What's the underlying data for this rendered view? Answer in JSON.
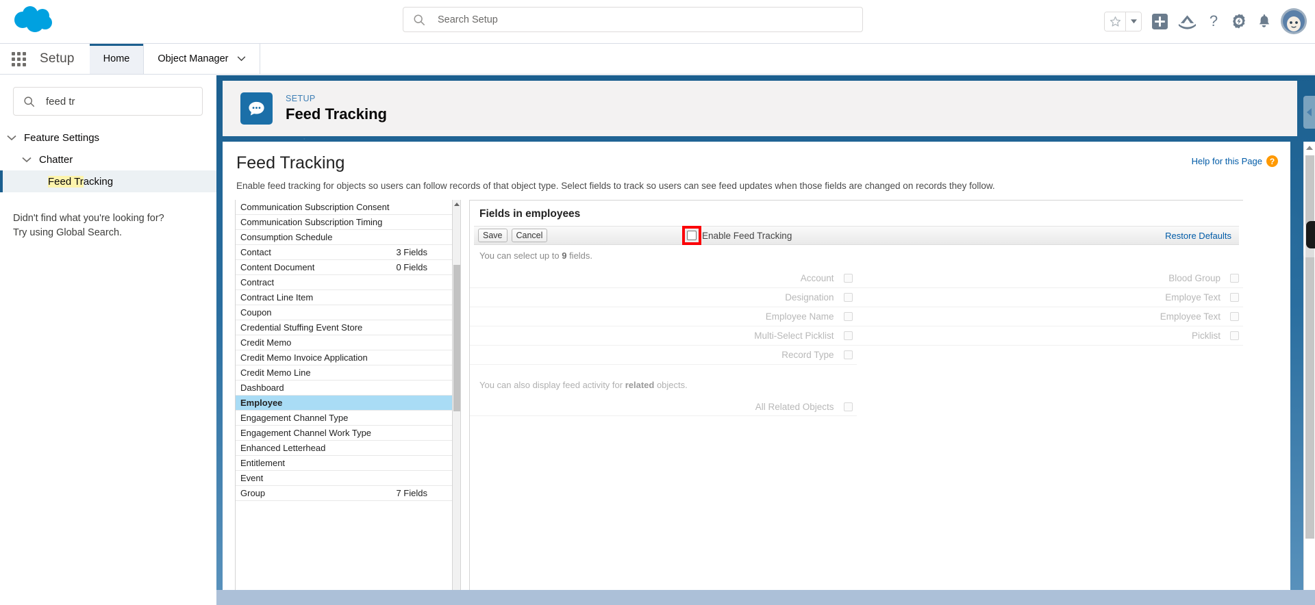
{
  "header": {
    "logo_icon": "salesforce-cloud-logo",
    "search": {
      "placeholder": "Search Setup",
      "value": "",
      "icon": "search-icon"
    },
    "icons": [
      {
        "name": "favorites-star-icon",
        "glyph": "star"
      },
      {
        "name": "favorites-dropdown-icon",
        "glyph": "caret-down"
      },
      {
        "name": "add-favorite-icon",
        "glyph": "plus-square"
      },
      {
        "name": "global-actions-icon",
        "glyph": "cloud-mountain"
      },
      {
        "name": "help-icon",
        "glyph": "question"
      },
      {
        "name": "setup-gear-icon",
        "glyph": "gear"
      },
      {
        "name": "notifications-bell-icon",
        "glyph": "bell"
      },
      {
        "name": "user-avatar",
        "glyph": "astro-avatar"
      }
    ]
  },
  "setup_nav": {
    "app_launcher_icon": "app-launcher-waffle-icon",
    "app_name": "Setup",
    "tabs": [
      {
        "label": "Home",
        "active": true,
        "has_caret": false
      },
      {
        "label": "Object Manager",
        "active": false,
        "has_caret": true
      }
    ]
  },
  "sidebar": {
    "search": {
      "value": "feed tr",
      "placeholder": "Quick Find",
      "icon": "search-icon"
    },
    "tree": [
      {
        "label": "Feature Settings",
        "level": 1,
        "expanded": true,
        "selected": false
      },
      {
        "label": "Chatter",
        "level": 2,
        "expanded": true,
        "selected": false
      },
      {
        "label": "Feed Tracking",
        "level": 3,
        "expanded": false,
        "selected": true,
        "highlight": "Feed Tr"
      }
    ],
    "note_line1": "Didn't find what you're looking for?",
    "note_line2": "Try using Global Search."
  },
  "page_header": {
    "icon": "chatter-feed-icon",
    "eyebrow": "SETUP",
    "title": "Feed Tracking"
  },
  "classic": {
    "help_link": "Help for this Page",
    "help_icon": "help-question-icon",
    "heading": "Feed Tracking",
    "description": "Enable feed tracking for objects so users can follow records of that object type. Select fields to track so users can see feed updates when those fields are changed on records they follow."
  },
  "object_list": {
    "selected": "Employee",
    "items": [
      {
        "name": "Communication Subscription Consent",
        "fields": ""
      },
      {
        "name": "Communication Subscription Timing",
        "fields": ""
      },
      {
        "name": "Consumption Schedule",
        "fields": ""
      },
      {
        "name": "Contact",
        "fields": "3 Fields"
      },
      {
        "name": "Content Document",
        "fields": "0 Fields"
      },
      {
        "name": "Contract",
        "fields": ""
      },
      {
        "name": "Contract Line Item",
        "fields": ""
      },
      {
        "name": "Coupon",
        "fields": ""
      },
      {
        "name": "Credential Stuffing Event Store",
        "fields": ""
      },
      {
        "name": "Credit Memo",
        "fields": ""
      },
      {
        "name": "Credit Memo Invoice Application",
        "fields": ""
      },
      {
        "name": "Credit Memo Line",
        "fields": ""
      },
      {
        "name": "Dashboard",
        "fields": ""
      },
      {
        "name": "Employee",
        "fields": ""
      },
      {
        "name": "Engagement Channel Type",
        "fields": ""
      },
      {
        "name": "Engagement Channel Work Type",
        "fields": ""
      },
      {
        "name": "Enhanced Letterhead",
        "fields": ""
      },
      {
        "name": "Entitlement",
        "fields": ""
      },
      {
        "name": "Event",
        "fields": ""
      },
      {
        "name": "Group",
        "fields": "7 Fields"
      }
    ]
  },
  "fields_panel": {
    "title": "Fields in employees",
    "save_label": "Save",
    "cancel_label": "Cancel",
    "enable_label": "Enable Feed Tracking",
    "enable_checked": false,
    "enable_highlighted": true,
    "highlight_color": "#fb0007",
    "restore_label": "Restore Defaults",
    "limit_note_pre": "You can select up to ",
    "limit_note_num": "9",
    "limit_note_post": " fields.",
    "left_fields": [
      {
        "label": "Account",
        "checked": false
      },
      {
        "label": "Designation",
        "checked": false
      },
      {
        "label": "Employee Name",
        "checked": false
      },
      {
        "label": "Multi-Select Picklist",
        "checked": false
      },
      {
        "label": "Record Type",
        "checked": false
      }
    ],
    "right_fields": [
      {
        "label": "Blood Group",
        "checked": false
      },
      {
        "label": "Employe Text",
        "checked": false
      },
      {
        "label": "Employee Text",
        "checked": false
      },
      {
        "label": "Picklist",
        "checked": false
      }
    ],
    "related_note_pre": "You can also display feed activity for ",
    "related_note_bold": "related",
    "related_note_post": " objects.",
    "all_related_label": "All Related Objects",
    "all_related_checked": false
  },
  "colors": {
    "brand_blue": "#1b5f8f",
    "link_blue": "#015ba7",
    "selected_row": "#a9dcf5",
    "sidebar_selected": "#ecf1f4",
    "highlight_yellow": "#fdf4ad"
  }
}
